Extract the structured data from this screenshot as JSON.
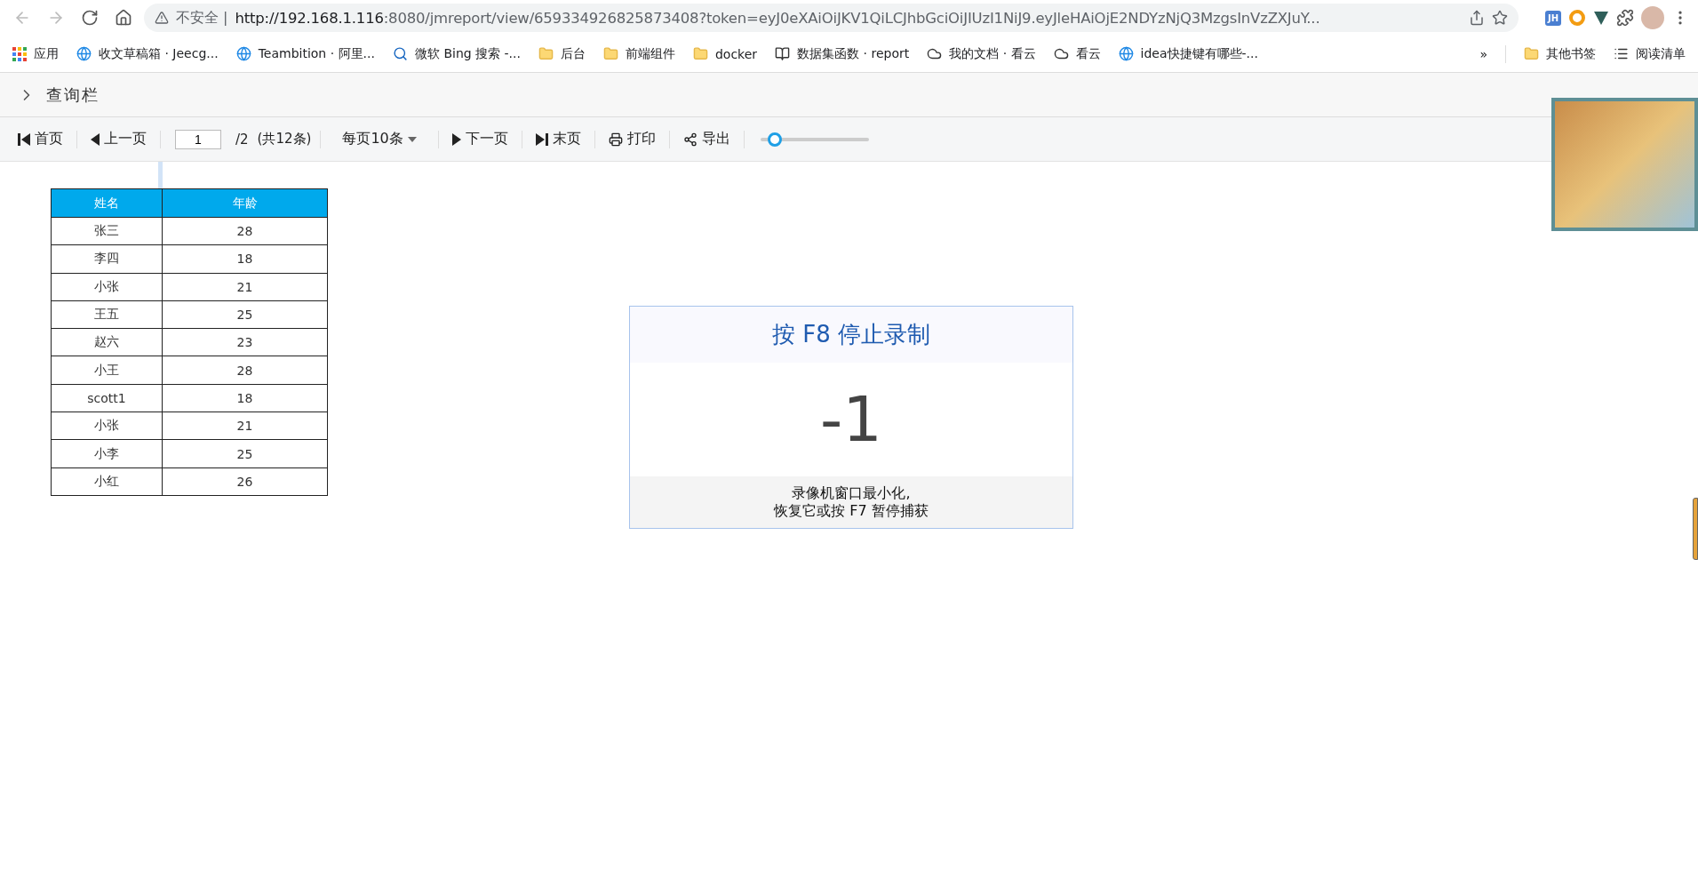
{
  "browser": {
    "security": "不安全 |",
    "url_host": "http://192.168.1.116",
    "url_rest": ":8080/jmreport/view/659334926825873408?token=eyJ0eXAiOiJKV1QiLCJhbGciOiJIUzI1NiJ9.eyJleHAiOjE2NDYzNjQ3MzgsInVzZXJuY...",
    "extension_badge": "JH"
  },
  "bookmarks": [
    {
      "kind": "apps",
      "label": "应用"
    },
    {
      "kind": "site",
      "label": "收文草稿箱 · Jeecg..."
    },
    {
      "kind": "site",
      "label": "Teambition · 阿里..."
    },
    {
      "kind": "search",
      "label": "微软 Bing 搜索 -..."
    },
    {
      "kind": "folder",
      "label": "后台"
    },
    {
      "kind": "folder",
      "label": "前端组件"
    },
    {
      "kind": "folder",
      "label": "docker"
    },
    {
      "kind": "book",
      "label": "数据集函数 · report"
    },
    {
      "kind": "cloud",
      "label": "我的文档 · 看云"
    },
    {
      "kind": "cloud",
      "label": "看云"
    },
    {
      "kind": "site",
      "label": "idea快捷键有哪些-..."
    }
  ],
  "bookmarks_more": "»",
  "bookmarks_right": [
    {
      "kind": "folder",
      "label": "其他书签"
    },
    {
      "kind": "list",
      "label": "阅读清单"
    }
  ],
  "query_bar": {
    "title": "查询栏",
    "expanded": false
  },
  "toolbar": {
    "first": "首页",
    "prev": "上一页",
    "page": "1",
    "total_pages": "/2",
    "count": "(共12条)",
    "page_size": "每页10条",
    "next": "下一页",
    "last": "末页",
    "print": "打印",
    "export": "导出",
    "zoom": {
      "level": 0.13
    }
  },
  "table": {
    "columns": [
      "姓名",
      "年龄"
    ],
    "rows": [
      [
        "张三",
        "28"
      ],
      [
        "李四",
        "18"
      ],
      [
        "小张",
        "21"
      ],
      [
        "王五",
        "25"
      ],
      [
        "赵六",
        "23"
      ],
      [
        "小王",
        "28"
      ],
      [
        "scott1",
        "18"
      ],
      [
        "小张",
        "21"
      ],
      [
        "小李",
        "25"
      ],
      [
        "小红",
        "26"
      ]
    ]
  },
  "recorder": {
    "title": "按 F8 停止录制",
    "countdown": "-1",
    "note_line1": "录像机窗口最小化,",
    "note_line2": "恢复它或按 F7 暂停捕获"
  }
}
